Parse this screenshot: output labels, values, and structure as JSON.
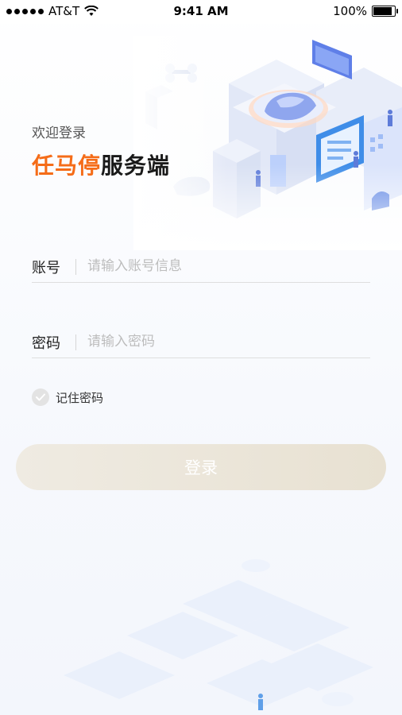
{
  "status_bar": {
    "carrier": "AT&T",
    "time": "9:41 AM",
    "battery": "100%"
  },
  "header": {
    "welcome": "欢迎登录",
    "brand_highlight": "任马停",
    "brand_rest": "服务端"
  },
  "form": {
    "account_label": "账号",
    "account_placeholder": "请输入账号信息",
    "account_value": "",
    "password_label": "密码",
    "password_placeholder": "请输入密码",
    "password_value": "",
    "remember_label": "记住密码",
    "remember_checked": false,
    "login_label": "登录"
  },
  "colors": {
    "brand_orange": "#f56c18",
    "button_bg": "#e9e3d6",
    "illustration_blue": "#6f8ff2"
  }
}
